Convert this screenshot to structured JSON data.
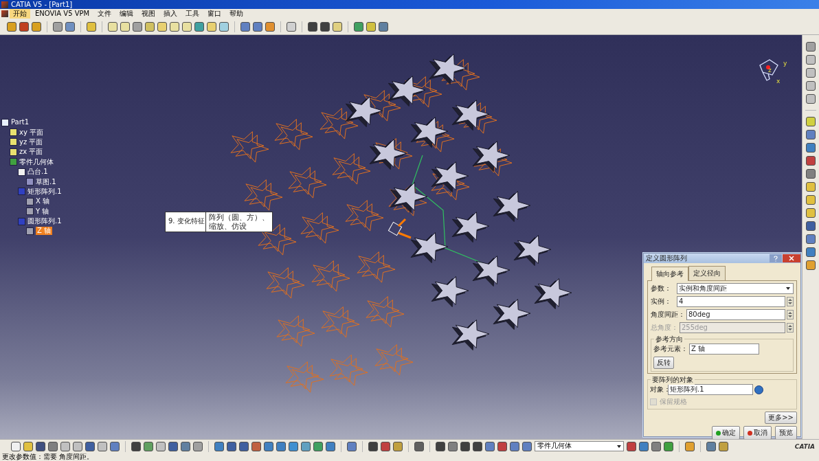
{
  "window": {
    "title": "CATIA V5 - [Part1]"
  },
  "menu": [
    {
      "label": "开始",
      "selected": true
    },
    {
      "label": "ENOVIA V5 VPM",
      "selected": false
    },
    {
      "label": "文件",
      "selected": false
    },
    {
      "label": "编辑",
      "selected": false
    },
    {
      "label": "视图",
      "selected": false
    },
    {
      "label": "插入",
      "selected": false
    },
    {
      "label": "工具",
      "selected": false
    },
    {
      "label": "窗口",
      "selected": false
    },
    {
      "label": "帮助",
      "selected": false
    }
  ],
  "tree": {
    "label": "Part1",
    "kind": "part",
    "selected": false,
    "children": [
      {
        "label": "xy 平面",
        "kind": "plane",
        "selected": false
      },
      {
        "label": "yz 平面",
        "kind": "plane",
        "selected": false
      },
      {
        "label": "zx 平面",
        "kind": "plane",
        "selected": false
      },
      {
        "label": "零件几何体",
        "kind": "body",
        "selected": false,
        "children": [
          {
            "label": "凸台.1",
            "kind": "pad",
            "selected": false,
            "children": [
              {
                "label": "草图.1",
                "kind": "sketch",
                "selected": false
              }
            ]
          },
          {
            "label": "矩形阵列.1",
            "kind": "pattern",
            "selected": false,
            "children": [
              {
                "label": "X 轴",
                "kind": "axis",
                "selected": false
              },
              {
                "label": "Y 轴",
                "kind": "axis",
                "selected": false
              }
            ]
          },
          {
            "label": "圆形阵列.1",
            "kind": "pattern",
            "selected": false,
            "children": [
              {
                "label": "Z 轴",
                "kind": "axis",
                "selected": true
              }
            ]
          }
        ]
      }
    ]
  },
  "tooltip": {
    "number": "9. 变化特征",
    "text": "阵列（圆、方）、缩放、仿设"
  },
  "compass": {
    "labels": [
      "y",
      "z",
      "x"
    ]
  },
  "dialog": {
    "title": "定义圆形阵列",
    "tabs": [
      {
        "label": "轴向参考",
        "selected": true
      },
      {
        "label": "定义径向",
        "selected": false
      }
    ],
    "parameters_label": "参数：",
    "parameters_value": "实例和角度间距",
    "fields": [
      {
        "label": "实例：",
        "value": "4",
        "disabled": false
      },
      {
        "label": "角度间距：",
        "value": "80deg",
        "disabled": false
      },
      {
        "label": "总角度：",
        "value": "255deg",
        "disabled": true
      }
    ],
    "reference_group": "参考方向",
    "reference_label": "参考元素：",
    "reference_value": "Z 轴",
    "reverse_button": "反转",
    "object_group": "要阵列的对象",
    "object_label": "对象：",
    "object_value": "矩形阵列.1",
    "keep_spec": {
      "label": "保留规格",
      "checked": false,
      "disabled": true
    },
    "more_button": "更多>>",
    "buttons": [
      {
        "label": "确定",
        "kind": "ok"
      },
      {
        "label": "取消",
        "kind": "cancel"
      },
      {
        "label": "预览",
        "kind": "preview"
      }
    ]
  },
  "bottom_combo": "零件几何体",
  "logo": "CATIA",
  "status_bar": "更改参数值：需要 角度间距。"
}
